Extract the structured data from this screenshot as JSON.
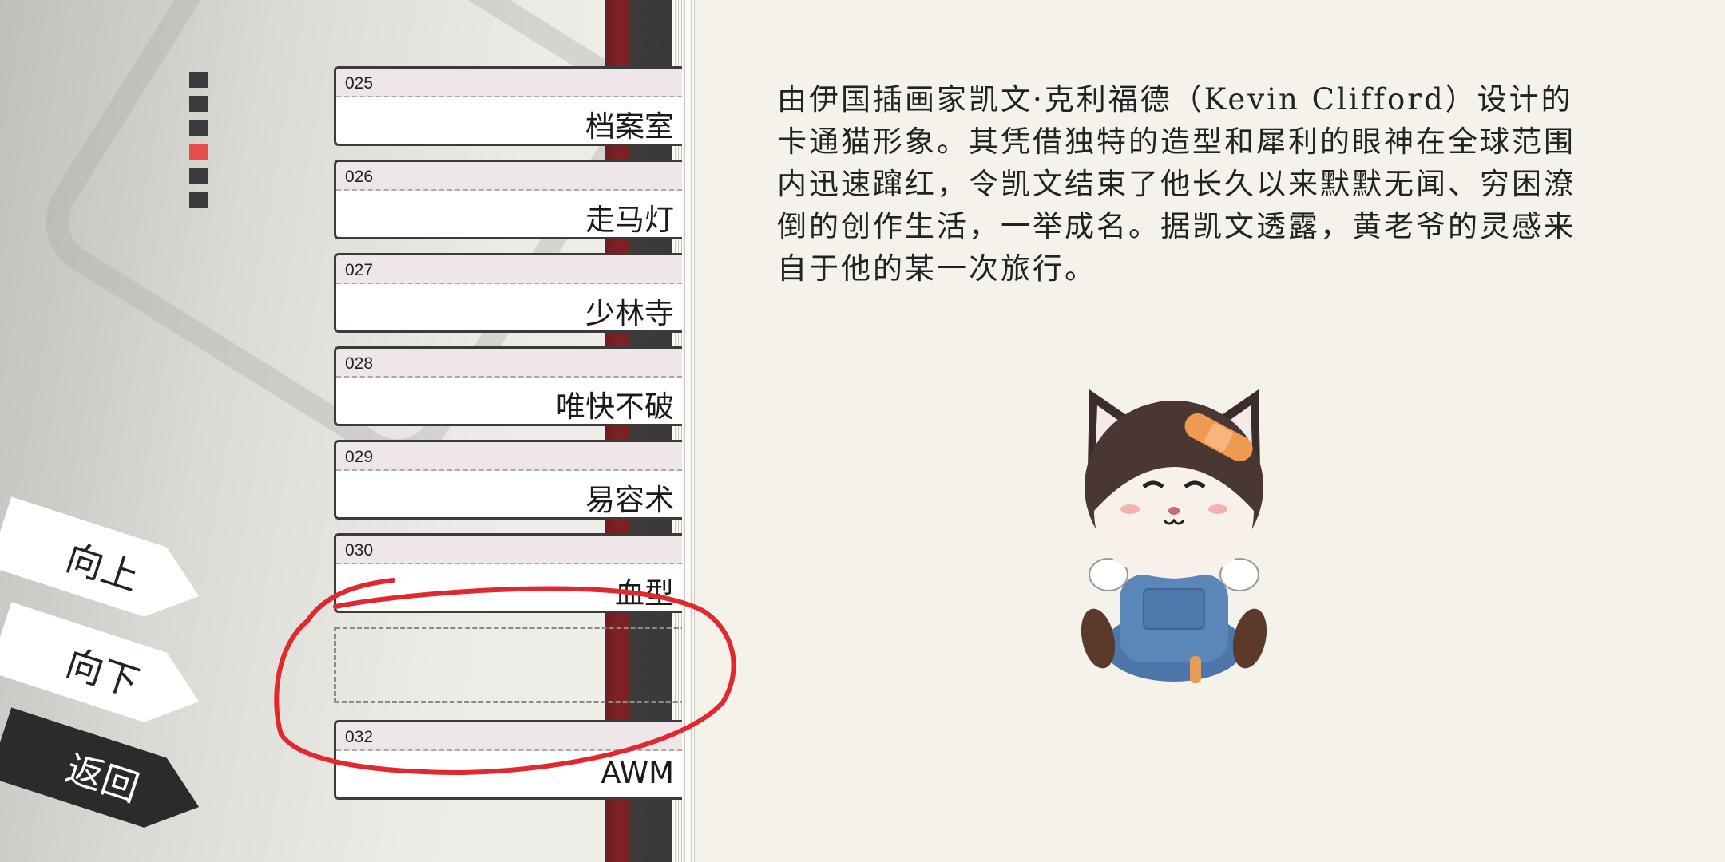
{
  "nav": {
    "up_label": "向上",
    "down_label": "向下",
    "back_label": "返回"
  },
  "page_indicator": {
    "total": 6,
    "active_index": 3
  },
  "items": [
    {
      "number": "025",
      "name": "档案室"
    },
    {
      "number": "026",
      "name": "走马灯"
    },
    {
      "number": "027",
      "name": "少林寺"
    },
    {
      "number": "028",
      "name": "唯快不破"
    },
    {
      "number": "029",
      "name": "易容术"
    },
    {
      "number": "030",
      "name": "血型"
    },
    {
      "number": "",
      "name": ""
    },
    {
      "number": "032",
      "name": "AWM"
    }
  ],
  "detail": {
    "description": "由伊国插画家凯文·克利福德（Kevin Clifford）设计的卡通猫形象。其凭借独特的造型和犀利的眼神在全球范围内迅速蹿红，令凯文结束了他长久以来默默无闻、穷困潦倒的创作生活，一举成名。据凯文透露，黄老爷的灵感来自于他的某一次旅行。",
    "image_icon": "cartoon-cat-icon"
  },
  "colors": {
    "accent_red": "#e84d4d",
    "annotation_red": "#e0282e",
    "dark": "#2b2b2d"
  }
}
